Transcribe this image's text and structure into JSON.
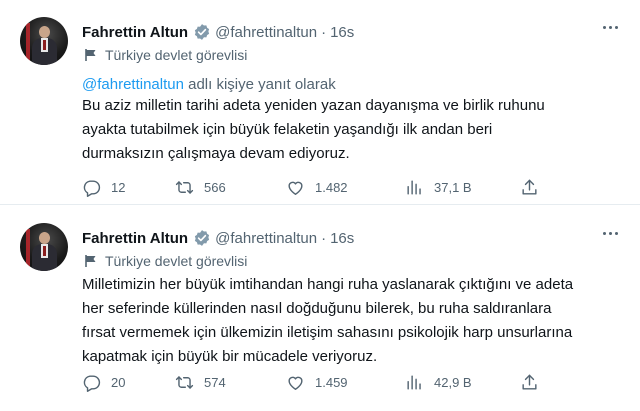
{
  "tweets": [
    {
      "name": "Fahrettin Altun",
      "handle": "@fahrettinaltun",
      "separator": "·",
      "time": "16s",
      "label": "Türkiye devlet görevlisi",
      "reply_to": {
        "mention": "@fahrettinaltun",
        "suffix": " adlı kişiye yanıt olarak"
      },
      "text_lines": [
        "Bu aziz milletin tarihi adeta yeniden yazan dayanışma ve birlik ruhunu",
        "ayakta tutabilmek için büyük felaketin yaşandığı ilk andan beri",
        "durmaksızın çalışmaya devam ediyoruz."
      ],
      "stats": {
        "replies": "12",
        "retweets": "566",
        "likes": "1.482",
        "views": "37,1 B"
      }
    },
    {
      "name": "Fahrettin Altun",
      "handle": "@fahrettinaltun",
      "separator": "·",
      "time": "16s",
      "label": "Türkiye devlet görevlisi",
      "text_lines": [
        "Milletimizin her büyük imtihandan hangi ruha yaslanarak çıktığını ve adeta",
        "her seferinde küllerinden nasıl doğduğunu bilerek, bu ruha saldıranlara",
        "fırsat vermemek için ülkemizin iletişim sahasını psikolojik harp unsurlarına",
        "kapatmak için büyük bir mücadele veriyoruz."
      ],
      "stats": {
        "replies": "20",
        "retweets": "574",
        "likes": "1.459",
        "views": "42,9 B"
      }
    }
  ],
  "icons": {
    "verified": "verified-badge-icon",
    "label": "flag-icon",
    "more": "more-icon",
    "reply": "reply-icon",
    "retweet": "retweet-icon",
    "like": "heart-icon",
    "views": "views-icon",
    "share": "share-icon"
  },
  "colors": {
    "accent": "#1d9bf0",
    "muted": "#536471",
    "text": "#0f1419",
    "verified_gray": "#829aab"
  }
}
